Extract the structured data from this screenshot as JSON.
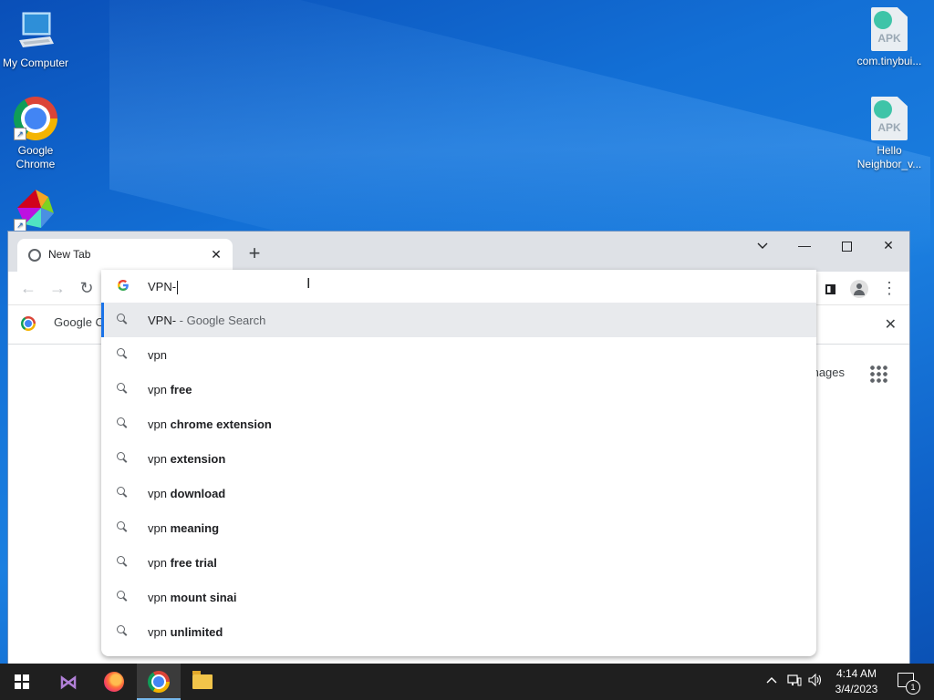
{
  "desktop": {
    "icons": [
      {
        "label": "My Computer"
      },
      {
        "label": "Google Chrome"
      },
      {
        "label": "com.tinybui..."
      },
      {
        "label": "Hello Neighbor_v..."
      }
    ],
    "apk_badge": "APK"
  },
  "browser": {
    "tab": {
      "title": "New Tab"
    },
    "bookmark": {
      "label": "Google C"
    },
    "ntp": {
      "images_link": "mages"
    }
  },
  "omnibox": {
    "input_value": "VPN-",
    "selected": {
      "query": "VPN-",
      "suffix": " - Google Search"
    },
    "suggestions": [
      {
        "prefix": "vpn",
        "bold": ""
      },
      {
        "prefix": "vpn ",
        "bold": "free"
      },
      {
        "prefix": "vpn ",
        "bold": "chrome extension"
      },
      {
        "prefix": "vpn ",
        "bold": "extension"
      },
      {
        "prefix": "vpn ",
        "bold": "download"
      },
      {
        "prefix": "vpn ",
        "bold": "meaning"
      },
      {
        "prefix": "vpn ",
        "bold": "free trial"
      },
      {
        "prefix": "vpn ",
        "bold": "mount sinai"
      },
      {
        "prefix": "vpn ",
        "bold": "unlimited"
      }
    ]
  },
  "taskbar": {
    "time": "4:14 AM",
    "date": "3/4/2023",
    "notification_count": "1"
  }
}
